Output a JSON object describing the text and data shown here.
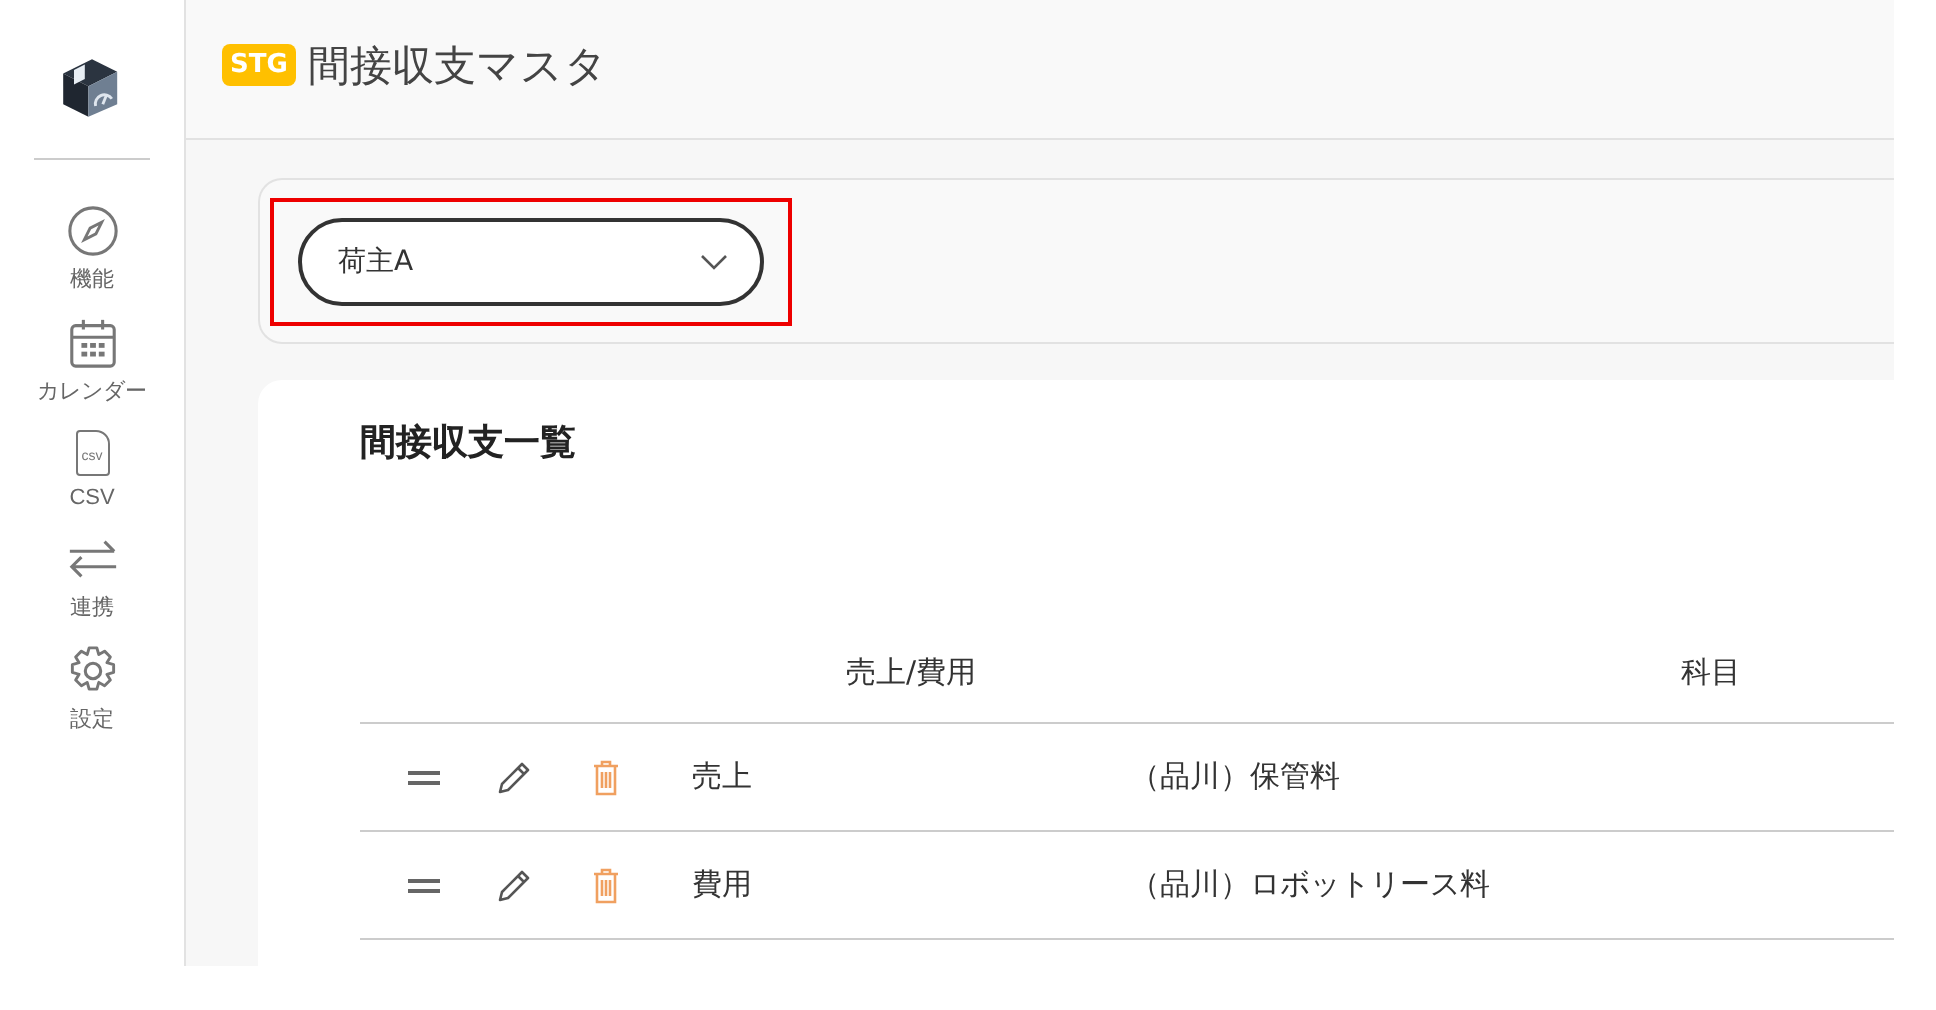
{
  "sidebar": {
    "items": [
      {
        "kind": "compass",
        "label": "機能"
      },
      {
        "kind": "calendar",
        "label": "カレンダー"
      },
      {
        "kind": "csv",
        "label": "CSV",
        "icon_text": "csv"
      },
      {
        "kind": "sync",
        "label": "連携"
      },
      {
        "kind": "settings",
        "label": "設定"
      }
    ]
  },
  "header": {
    "badge": "STG",
    "title": "間接収支マスタ"
  },
  "filter": {
    "shipper": {
      "value": "荷主A",
      "highlighted": true
    }
  },
  "list": {
    "title": "間接収支一覧",
    "columns": [
      "売上/費用",
      "科目"
    ],
    "rows": [
      {
        "type": "売上",
        "subject": "（品川）保管料"
      },
      {
        "type": "費用",
        "subject": "（品川）ロボットリース料"
      }
    ]
  }
}
